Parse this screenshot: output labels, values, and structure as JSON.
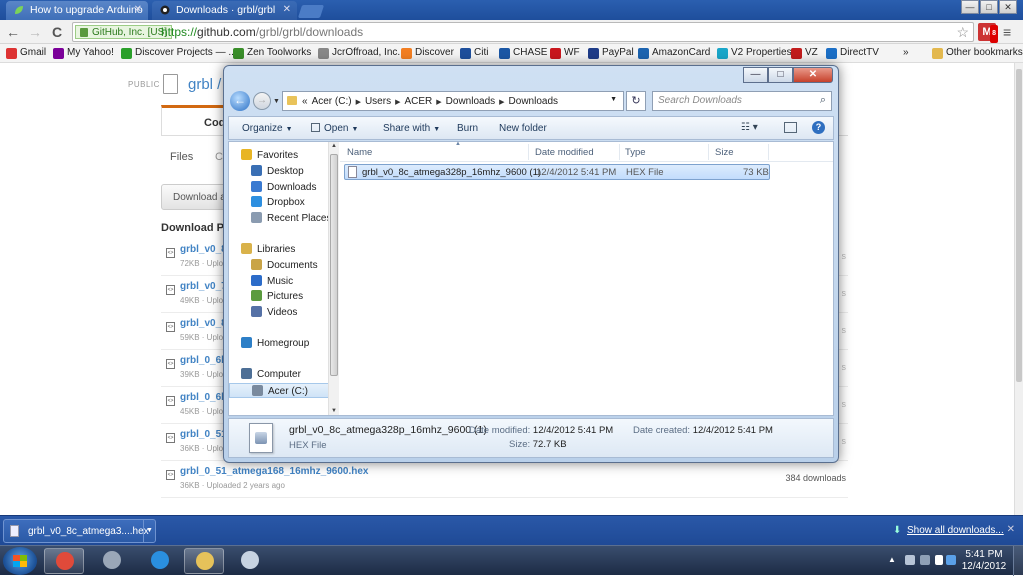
{
  "browser": {
    "tabs": [
      {
        "title": "How to upgrade Arduino"
      },
      {
        "title": "Downloads · grbl/grbl"
      }
    ],
    "window_controls": {
      "minimize": "—",
      "maximize": "□",
      "close": "✕"
    },
    "nav": {
      "back": "←",
      "forward": "→",
      "reload": "C"
    },
    "omnibox": {
      "ev_label": "GitHub, Inc. [US]",
      "url_scheme": "https://",
      "url_host": "github.com",
      "url_path": "/grbl/grbl/downloads"
    },
    "extension": {
      "badge": "8"
    },
    "bookmarks": [
      {
        "label": "Gmail",
        "icon": "gmail-icon",
        "color": "#d33"
      },
      {
        "label": "My Yahoo!",
        "icon": "yahoo-icon",
        "color": "#7b0099"
      },
      {
        "label": "Discover Projects — ...",
        "icon": "kickstarter-icon",
        "color": "#2a9f2a"
      },
      {
        "label": "Zen Toolworks",
        "icon": "leaf-icon",
        "color": "#3a8e2a"
      },
      {
        "label": "JcrOffroad, Inc.",
        "icon": "doc-icon",
        "color": "#888"
      },
      {
        "label": "Discover",
        "icon": "discover-icon",
        "color": "#f27e22"
      },
      {
        "label": "Citi",
        "icon": "citi-icon",
        "color": "#1e4f9c"
      },
      {
        "label": "CHASE",
        "icon": "chase-icon",
        "color": "#1b57a5"
      },
      {
        "label": "WF",
        "icon": "wf-icon",
        "color": "#c9171e"
      },
      {
        "label": "PayPal",
        "icon": "paypal-icon",
        "color": "#1f3c88"
      },
      {
        "label": "AmazonCard",
        "icon": "amazon-icon",
        "color": "#1d64b0"
      },
      {
        "label": "V2 Properties",
        "icon": "v2-icon",
        "color": "#1aa6c9"
      },
      {
        "label": "VZ",
        "icon": "vz-icon",
        "color": "#c21d1d"
      },
      {
        "label": "DirectTV",
        "icon": "directv-icon",
        "color": "#1c6fc6"
      }
    ],
    "other_bookmarks": "Other bookmarks",
    "overflow": "»"
  },
  "github": {
    "public_label": "PUBLIC",
    "repo_owner": "grbl /",
    "code_tab": "Code",
    "files_tab": "Files",
    "files_tab_next": "C",
    "download_button": "Download a",
    "downloads_heading": "Download P",
    "files": [
      {
        "name": "grbl_v0_8",
        "meta": "72KB · Uplo",
        "downloads": "s"
      },
      {
        "name": "grbl_v0_7",
        "meta": "49KB · Uplo",
        "downloads": "s"
      },
      {
        "name": "grbl_v0_8",
        "meta": "59KB · Uplo",
        "downloads": "s"
      },
      {
        "name": "grbl_0_6b",
        "meta": "39KB · Uplo",
        "downloads": "s"
      },
      {
        "name": "grbl_0_6b",
        "meta": "45KB · Uplo",
        "downloads": "s"
      },
      {
        "name": "grbl_0_51",
        "meta": "36KB · Uplo",
        "downloads": "s"
      },
      {
        "name": "grbl_0_51_atmega168_16mhz_9600.hex",
        "meta": "36KB · Uploaded 2 years ago",
        "downloads": "384 downloads"
      }
    ]
  },
  "explorer": {
    "window_controls": {
      "minimize": "—",
      "maximize": "□",
      "close": "✕"
    },
    "breadcrumb": [
      "«",
      "Acer (C:)",
      "Users",
      "ACER",
      "Downloads",
      "Downloads"
    ],
    "search_placeholder": "Search Downloads",
    "commands": {
      "organize": "Organize",
      "open": "Open",
      "share_with": "Share with",
      "burn": "Burn",
      "new_folder": "New folder"
    },
    "nav_pane": [
      {
        "label": "Favorites",
        "icon": "star-icon",
        "color": "#e8b524",
        "indent": 0
      },
      {
        "label": "Desktop",
        "icon": "desktop-icon",
        "color": "#3a6fb4",
        "indent": 1
      },
      {
        "label": "Downloads",
        "icon": "downloads-folder-icon",
        "color": "#3a7ad1",
        "indent": 1
      },
      {
        "label": "Dropbox",
        "icon": "dropbox-icon",
        "color": "#2d8fe0",
        "indent": 1
      },
      {
        "label": "Recent Places",
        "icon": "recent-places-icon",
        "color": "#8a9bb0",
        "indent": 1
      },
      {
        "label": "Libraries",
        "icon": "libraries-icon",
        "color": "#d9b24a",
        "indent": 0
      },
      {
        "label": "Documents",
        "icon": "documents-icon",
        "color": "#c9a447",
        "indent": 1
      },
      {
        "label": "Music",
        "icon": "music-icon",
        "color": "#2c6cc9",
        "indent": 1
      },
      {
        "label": "Pictures",
        "icon": "pictures-icon",
        "color": "#5b9b3f",
        "indent": 1
      },
      {
        "label": "Videos",
        "icon": "videos-icon",
        "color": "#5571a6",
        "indent": 1
      },
      {
        "label": "Homegroup",
        "icon": "homegroup-icon",
        "color": "#2d7fc7",
        "indent": 0
      },
      {
        "label": "Computer",
        "icon": "computer-icon",
        "color": "#4d6f96",
        "indent": 0
      },
      {
        "label": "Acer (C:)",
        "icon": "drive-icon",
        "color": "#7a8a9e",
        "indent": 1,
        "selected": true
      },
      {
        "label": "Network",
        "icon": "network-icon",
        "color": "#3e7bbf",
        "indent": 0
      }
    ],
    "columns": {
      "name": "Name",
      "date": "Date modified",
      "type": "Type",
      "size": "Size"
    },
    "files": [
      {
        "name": "grbl_v0_8c_atmega328p_16mhz_9600 (1)",
        "date": "12/4/2012 5:41 PM",
        "type": "HEX File",
        "size": "73 KB"
      }
    ],
    "details": {
      "name": "grbl_v0_8c_atmega328p_16mhz_9600 (1)",
      "type": "HEX File",
      "date_modified_label": "Date modified:",
      "date_modified": "12/4/2012 5:41 PM",
      "size_label": "Size:",
      "size": "72.7 KB",
      "date_created_label": "Date created:",
      "date_created": "12/4/2012 5:41 PM"
    }
  },
  "download_shelf": {
    "item_label": "grbl_v0_8c_atmega3....hex",
    "show_all": "Show all downloads...",
    "close": "✕"
  },
  "taskbar": {
    "apps": [
      {
        "name": "chrome-icon",
        "color": "#e04a3a",
        "active": true
      },
      {
        "name": "paint-tools-icon",
        "color": "#9aa7b8",
        "active": false
      },
      {
        "name": "internet-explorer-icon",
        "color": "#2a8fe0",
        "active": false
      },
      {
        "name": "file-explorer-icon",
        "color": "#e6c25a",
        "active": true
      },
      {
        "name": "paint-icon",
        "color": "#c7d3e2",
        "active": false
      }
    ],
    "time": "5:41 PM",
    "date": "12/4/2012"
  }
}
